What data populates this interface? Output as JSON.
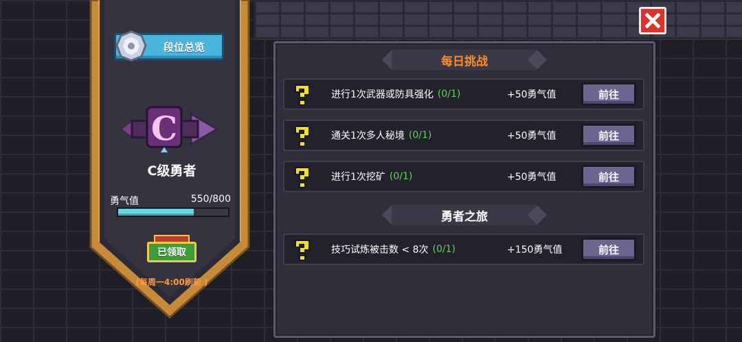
{
  "sidebar": {
    "rank_overview_label": "段位总览",
    "rank_title": "C级勇者",
    "courage_label": "勇气值",
    "courage_value": "550/800",
    "courage_progress": 0.6875,
    "claimed_label": "已领取",
    "refresh_note": "(每周一4:00刷新 )"
  },
  "daily": {
    "title": "每日挑战",
    "tasks": [
      {
        "desc": "进行1次武器或防具强化",
        "progress": "(0/1)",
        "reward": "+50勇气值",
        "button": "前往"
      },
      {
        "desc": "通关1次多人秘境",
        "progress": "(0/1)",
        "reward": "+50勇气值",
        "button": "前往"
      },
      {
        "desc": "进行1次挖矿",
        "progress": "(0/1)",
        "reward": "+50勇气值",
        "button": "前往"
      }
    ]
  },
  "journey": {
    "title": "勇者之旅",
    "tasks": [
      {
        "desc": "技巧试炼被击数 < 8次",
        "progress": "(0/1)",
        "reward": "+150勇气值",
        "button": "前往"
      }
    ]
  },
  "colors": {
    "daily_title": "#ff8a2a",
    "journey_title": "#ffffff",
    "progress_text": "#5fd35a",
    "accent_blue": "#4ab6de",
    "close_red": "#d8342e"
  },
  "icons": [
    "rank-emblem-icon",
    "rank-c-badge-icon",
    "chest-icon",
    "close-icon",
    "question-mark-icon"
  ]
}
